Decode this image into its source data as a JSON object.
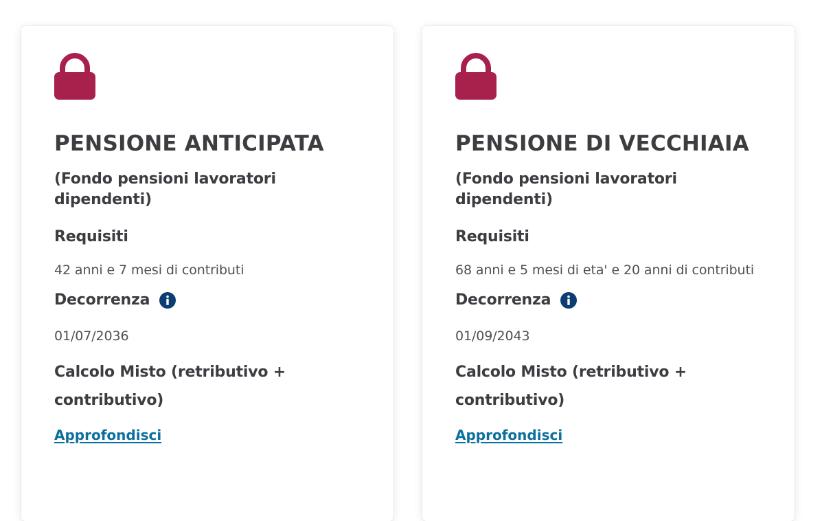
{
  "cards": [
    {
      "icon": "lock-icon",
      "title": "PENSIONE ANTICIPATA",
      "subtitle": "(Fondo pensioni lavoratori dipendenti)",
      "requisiti_label": "Requisiti",
      "requisiti_value": "42 anni e 7 mesi di contributi",
      "decorrenza_label": "Decorrenza",
      "decorrenza_info_icon": "info-icon",
      "decorrenza_value": "01/07/2036",
      "calcolo": "Calcolo Misto (retributivo + contributivo)",
      "link": "Approfondisci"
    },
    {
      "icon": "lock-icon",
      "title": "PENSIONE DI VECCHIAIA",
      "subtitle": "(Fondo pensioni lavoratori dipendenti)",
      "requisiti_label": "Requisiti",
      "requisiti_value": "68 anni e 5 mesi di eta' e 20 anni di contributi",
      "decorrenza_label": "Decorrenza",
      "decorrenza_info_icon": "info-icon",
      "decorrenza_value": "01/09/2043",
      "calcolo": "Calcolo Misto (retributivo + contributivo)",
      "link": "Approfondisci"
    }
  ],
  "colors": {
    "lock": "#a8204c",
    "info": "#0b3d72",
    "link": "#0b6fa0",
    "text": "#3b3d41"
  }
}
